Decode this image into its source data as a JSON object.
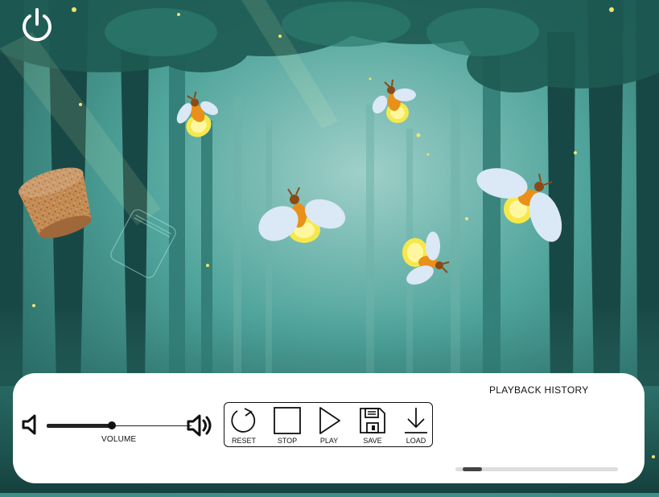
{
  "scene": {
    "fireflies": [
      {
        "id": "firefly-1"
      },
      {
        "id": "firefly-2"
      },
      {
        "id": "firefly-3"
      },
      {
        "id": "firefly-4"
      },
      {
        "id": "firefly-5"
      }
    ]
  },
  "controls": {
    "volume": {
      "label": "VOLUME",
      "level": 0.45
    },
    "buttons": {
      "reset": "RESET",
      "stop": "STOP",
      "play": "PLAY",
      "save": "SAVE",
      "load": "LOAD"
    }
  },
  "playback_history": {
    "title": "PLAYBACK HISTORY",
    "scroll_position": 0.05
  },
  "colors": {
    "forest": "#3d8f88",
    "panel": "#ffffff",
    "firefly_body": "#e8901a",
    "firefly_glow": "#f6e84a",
    "firefly_wing": "#dbe8f6"
  }
}
